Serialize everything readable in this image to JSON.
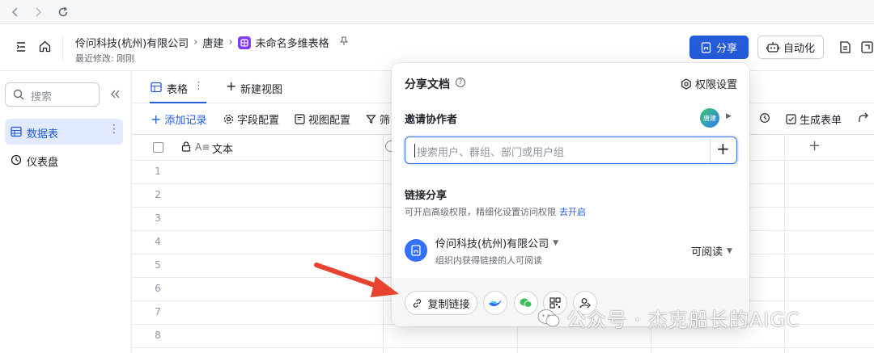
{
  "colors": {
    "accent": "#245bdb",
    "arrow": "#e8432e"
  },
  "header": {
    "breadcrumb": [
      "伶问科技(杭州)有限公司",
      "唐建",
      "未命名多维表格"
    ],
    "subtitle": "最近修改: 刚刚",
    "share_label": "分享",
    "automation_label": "自动化"
  },
  "sidebar": {
    "search_placeholder": "搜索",
    "items": [
      {
        "label": "数据表",
        "active": true
      },
      {
        "label": "仪表盘",
        "active": false
      }
    ]
  },
  "views": {
    "tab_label": "表格",
    "new_view_label": "新建视图"
  },
  "toolbar": {
    "add_record": "添加记录",
    "field_config": "字段配置",
    "view_config": "视图配置",
    "filter": "筛",
    "generate_form": "生成表单"
  },
  "table": {
    "col_text": "文本",
    "rows": [
      "1",
      "2",
      "3",
      "4",
      "5",
      "6",
      "7",
      "8"
    ]
  },
  "share_panel": {
    "title": "分享文档",
    "permission_settings": "权限设置",
    "invite_label": "邀请协作者",
    "avatar_text": "唐建",
    "invite_placeholder": "搜索用户、群组、部门或用户组",
    "link_share_label": "链接分享",
    "link_share_desc": "可开启高级权限，精细化设置访问权限",
    "enable_link": "去开启",
    "org_name": "伶问科技(杭州)有限公司",
    "org_desc": "组织内获得链接的人可阅读",
    "perm_value": "可阅读",
    "copy_link": "复制链接"
  },
  "watermark": {
    "text": "公众号 · 杰克船长的AIGC"
  }
}
